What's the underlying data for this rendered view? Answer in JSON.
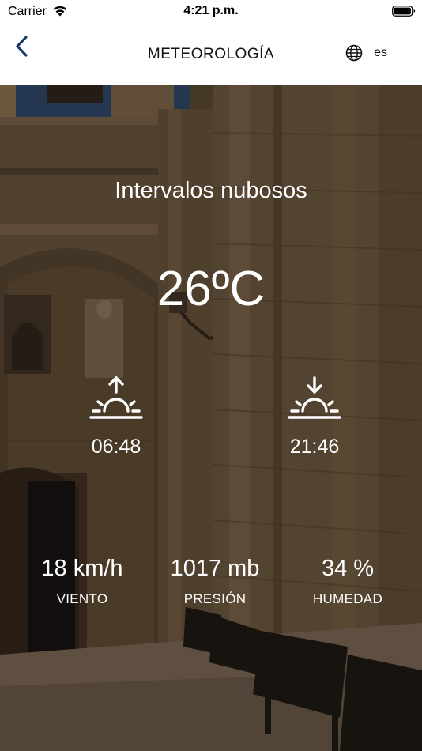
{
  "status_bar": {
    "carrier": "Carrier",
    "time": "4:21 p.m."
  },
  "nav": {
    "title": "METEOROLOGÍA",
    "language": "es",
    "back_icon": "chevron-left-icon",
    "language_icon": "globe-icon"
  },
  "weather": {
    "condition": "Intervalos nubosos",
    "temperature": "26ºC",
    "sunrise": "06:48",
    "sunset": "21:46",
    "sunrise_icon": "sunrise-icon",
    "sunset_icon": "sunset-icon",
    "stats": [
      {
        "value": "18 km/h",
        "label": "VIENTO"
      },
      {
        "value": "1017 mb",
        "label": "PRESIÓN"
      },
      {
        "value": "34 %",
        "label": "HUMEDAD"
      }
    ]
  },
  "colors": {
    "text_on_photo": "#ffffff",
    "nav_text": "#111111",
    "stone_tone": "#5c4a35"
  }
}
